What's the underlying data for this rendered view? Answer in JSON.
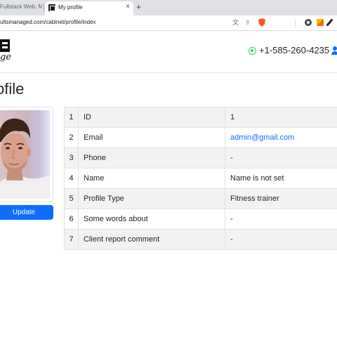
{
  "browser": {
    "inactive_tab_title": "Fullstack Web, Mo",
    "active_tab_title": "My profile",
    "tab_close": "×",
    "new_tab": "+",
    "url": "ultsmanaged.com/cabinet/profile/index"
  },
  "header": {
    "phone": "+1-585-260-4235",
    "logo_script": "ge"
  },
  "page": {
    "title": "ofile"
  },
  "sidebar": {
    "update_label": "Update"
  },
  "table": {
    "rows": [
      {
        "num": "1",
        "label": "ID",
        "value": "1"
      },
      {
        "num": "2",
        "label": "Email",
        "value": "admin@gmail.com"
      },
      {
        "num": "3",
        "label": "Phone",
        "value": "-"
      },
      {
        "num": "4",
        "label": "Name",
        "value": "Name is not set"
      },
      {
        "num": "5",
        "label": "Profile Type",
        "value": "Fitness trainer"
      },
      {
        "num": "6",
        "label": "Some words about",
        "value": "-"
      },
      {
        "num": "7",
        "label": "Client report comment",
        "value": "-"
      }
    ]
  },
  "icons": [
    "tab-favicon",
    "translate-icon",
    "share-icon",
    "brave-shield-icon",
    "extension-gear-icon",
    "extension-flag-icon",
    "pen-icon",
    "whatsapp-icon",
    "user-icon"
  ],
  "colors": {
    "primary": "#0d6efd",
    "whatsapp": "#25d366",
    "stripe": "#f2f2f2",
    "border": "#dee2e6"
  }
}
